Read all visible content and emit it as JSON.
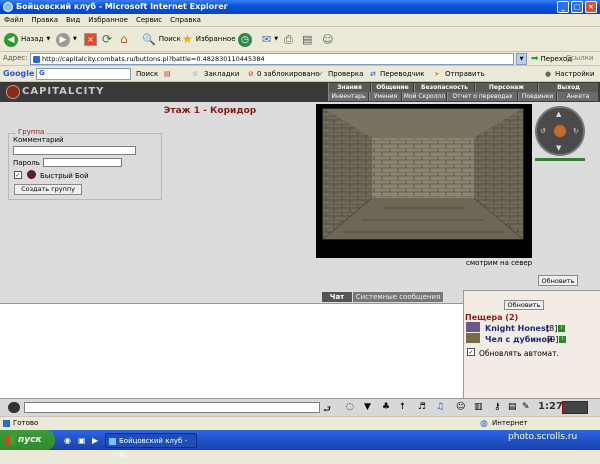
{
  "window": {
    "title": "Бойцовский клуб - Microsoft Internet Explorer"
  },
  "menu": [
    "Файл",
    "Правка",
    "Вид",
    "Избранное",
    "Сервис",
    "Справка"
  ],
  "toolbar": {
    "back": "Назад",
    "search": "Поиск",
    "favorites": "Избранное"
  },
  "address": {
    "label": "Адрес:",
    "url": "http://capitalcity.combats.ru/buttons.pl?battle=0.482830110445384",
    "go": "Переход",
    "links": "Ссылки"
  },
  "google": {
    "logo": "Google",
    "search": "Поиск",
    "bookmarks": "Закладки",
    "blocked": "0 заблокировано",
    "check": "Проверка",
    "translate": "Переводчик",
    "send": "Отправить",
    "settings": "Настройки"
  },
  "game": {
    "logo": "CAPITALCITY",
    "nav_top": [
      "Знания",
      "Общение",
      "Безопасность",
      "Персонаж",
      "Выход"
    ],
    "nav_bottom": [
      "Инвентарь",
      "Умения",
      "Мой Скроллл",
      "Отчет о переводах",
      "Поединки",
      "Анкета"
    ],
    "room_title": "Этаж 1 - Коридор",
    "group": {
      "legend": "Группа",
      "comment_label": "Комментарий",
      "password_label": "Пароль",
      "quick_fight": "Быстрый Бой",
      "create_btn": "Создать группу"
    },
    "view_caption": "смотрим на север",
    "refresh_btn": "Обновить",
    "tabs": {
      "chat": "Чат",
      "system": "Системные сообщения"
    },
    "right": {
      "refresh_btn": "Обновить",
      "location": "Пещера (2)",
      "players": [
        {
          "name": "Knight Honest",
          "level": "[8]"
        },
        {
          "name": "Чел с дубиной",
          "level": "[9]"
        }
      ],
      "auto_refresh": "Обновлять автомат."
    },
    "clock": "1:27"
  },
  "status": {
    "done": "Готово",
    "zone": "Интернет"
  },
  "taskbar": {
    "start": "пуск",
    "task": "Бойцовский клуб - M..."
  },
  "watermark": "photo.scrolls.ru"
}
